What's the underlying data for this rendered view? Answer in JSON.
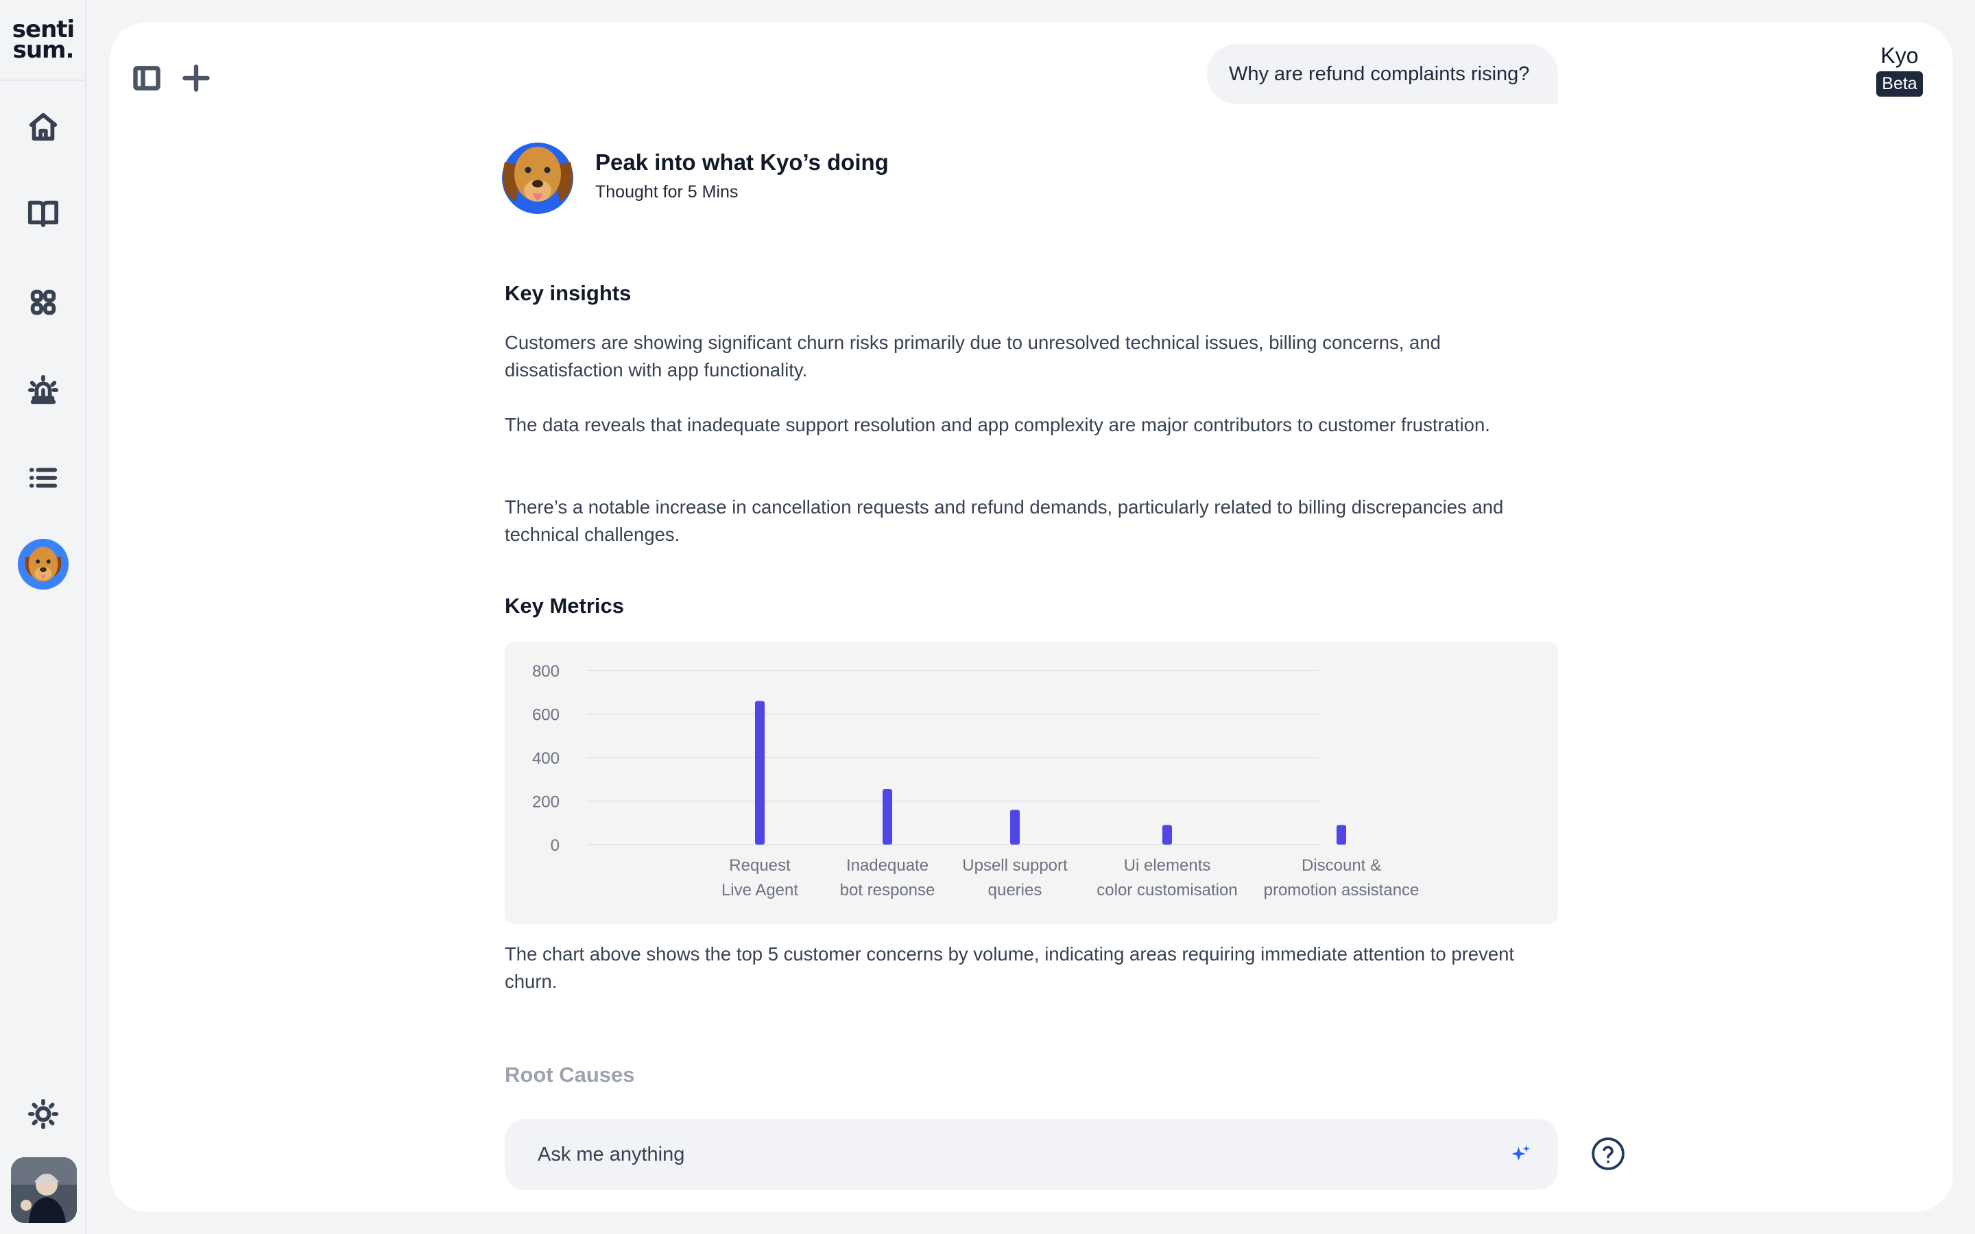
{
  "brand": {
    "logo_line1": "senti",
    "logo_line2": "sum."
  },
  "sidebar": {
    "items": [
      {
        "name": "home",
        "icon": "home-icon"
      },
      {
        "name": "library",
        "icon": "book-open-icon"
      },
      {
        "name": "apps",
        "icon": "grid-icon"
      },
      {
        "name": "alerts",
        "icon": "siren-icon"
      },
      {
        "name": "lists",
        "icon": "list-icon"
      },
      {
        "name": "kyo",
        "icon": "dog-avatar-icon"
      }
    ],
    "bottom": [
      {
        "name": "theme",
        "icon": "sun-icon"
      },
      {
        "name": "profile",
        "icon": "user-avatar"
      }
    ]
  },
  "header": {
    "agent_name": "Kyo",
    "badge": "Beta",
    "toggle_icon": "sidebar-toggle-icon",
    "new_icon": "plus-icon"
  },
  "conversation": {
    "user_message": "Why are refund complaints rising?",
    "thinking": {
      "title": "Peak into what Kyo’s doing",
      "subtitle": "Thought for 5 Mins"
    },
    "insights": {
      "heading": "Key insights",
      "paragraphs": [
        "Customers are showing significant churn risks primarily due to unresolved technical issues, billing concerns, and dissatisfaction with app functionality.",
        "The data reveals that inadequate support resolution and app complexity are major contributors to customer frustration.",
        "There’s a notable increase in cancellation requests and refund demands, particularly related to billing discrepancies and technical challenges."
      ]
    },
    "metrics": {
      "heading": "Key Metrics",
      "caption": "The chart above shows the top 5 customer concerns by volume, indicating areas requiring immediate attention to prevent churn."
    },
    "next_heading": "Root Causes"
  },
  "input": {
    "placeholder": "Ask me anything"
  },
  "colors": {
    "bar": "#4f46e5",
    "badge_bg": "#1e293b",
    "panel_bg": "#ffffff",
    "app_bg": "#f3f4f6"
  },
  "chart_data": {
    "type": "bar",
    "categories": [
      [
        "Request",
        "Live Agent"
      ],
      [
        "Inadequate",
        "bot response"
      ],
      [
        "Upsell support",
        "queries"
      ],
      [
        "Ui elements",
        "color customisation"
      ],
      [
        "Discount &",
        "promotion assistance"
      ]
    ],
    "values": [
      660,
      255,
      160,
      90,
      90
    ],
    "yticks": [
      0,
      200,
      400,
      600,
      800
    ],
    "ylim": [
      0,
      800
    ],
    "grid": true,
    "legend": "none"
  }
}
